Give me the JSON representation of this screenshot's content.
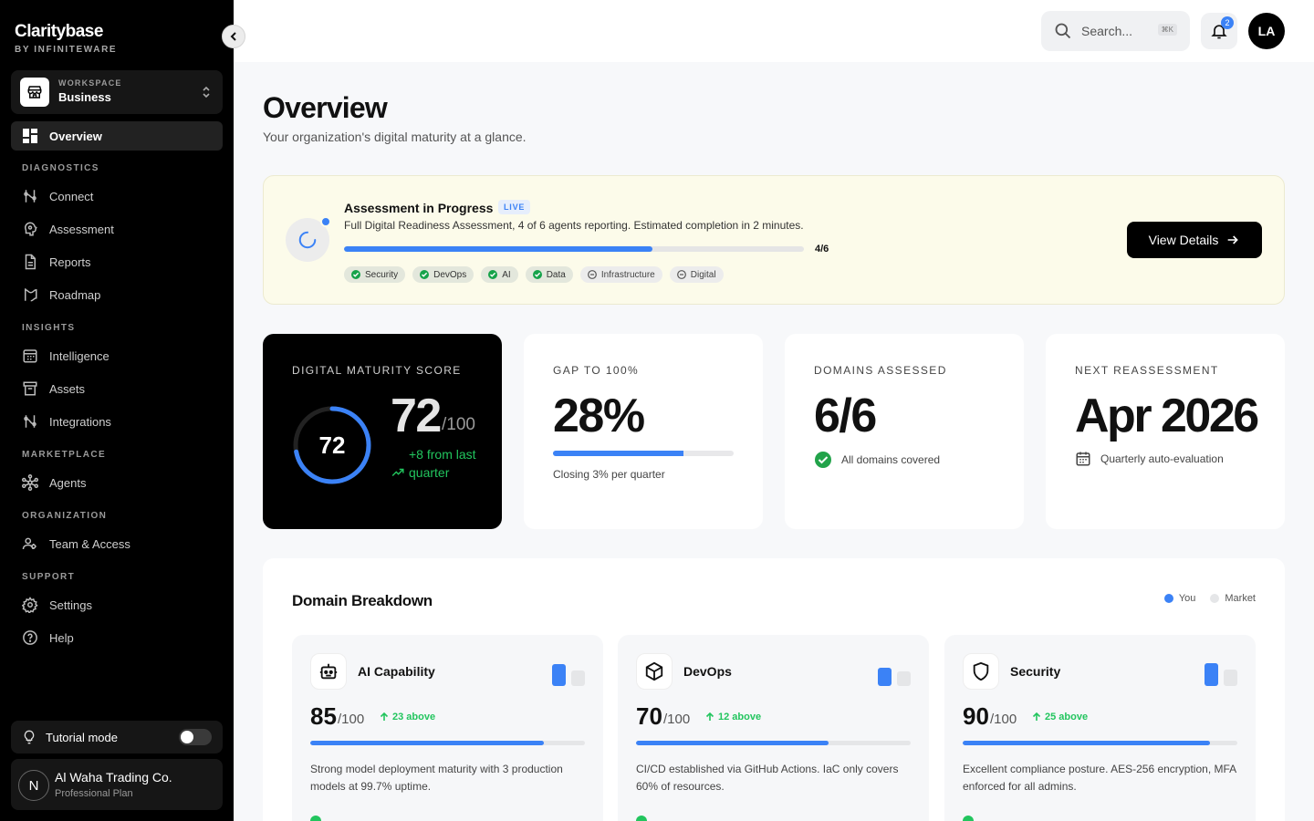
{
  "brand": {
    "name": "Claritybase",
    "by": "BY INFINITEWARE"
  },
  "workspace": {
    "label": "WORKSPACE",
    "value": "Business"
  },
  "nav": {
    "overview": "Overview",
    "sections": {
      "diagnostics": "DIAGNOSTICS",
      "insights": "INSIGHTS",
      "marketplace": "MARKETPLACE",
      "organization": "ORGANIZATION",
      "support": "SUPPORT"
    },
    "items": {
      "connect": "Connect",
      "assessment": "Assessment",
      "reports": "Reports",
      "roadmap": "Roadmap",
      "intelligence": "Intelligence",
      "assets": "Assets",
      "integrations": "Integrations",
      "agents": "Agents",
      "team": "Team & Access",
      "settings": "Settings",
      "help": "Help"
    }
  },
  "tutorial": {
    "label": "Tutorial mode",
    "enabled": false
  },
  "org": {
    "initial": "N",
    "name": "Al Waha Trading Co.",
    "plan": "Professional Plan"
  },
  "topbar": {
    "search_placeholder": "Search...",
    "shortcut": "⌘K",
    "notifications": "2",
    "avatar": "LA"
  },
  "page": {
    "title": "Overview",
    "subtitle": "Your organization's digital maturity at a glance."
  },
  "assessment": {
    "title": "Assessment in Progress",
    "badge": "LIVE",
    "description": "Full Digital Readiness Assessment, 4 of 6 agents reporting. Estimated completion in 2 minutes.",
    "progress": 0.67,
    "fraction": "4/6",
    "chips": [
      {
        "label": "Security",
        "done": true
      },
      {
        "label": "DevOps",
        "done": true
      },
      {
        "label": "AI",
        "done": true
      },
      {
        "label": "Data",
        "done": true
      },
      {
        "label": "Infrastructure",
        "done": false
      },
      {
        "label": "Digital",
        "done": false
      }
    ],
    "button": "View Details"
  },
  "cards": {
    "maturity": {
      "label": "DIGITAL MATURITY SCORE",
      "value": "72",
      "of": "/100",
      "gauge_value": 72,
      "trend": "+8 from last quarter"
    },
    "gap": {
      "label": "GAP TO 100%",
      "value": "28%",
      "progress": 0.72,
      "note": "Closing 3% per quarter"
    },
    "domains": {
      "label": "DOMAINS ASSESSED",
      "value": "6/6",
      "note": "All domains covered"
    },
    "next": {
      "label": "NEXT REASSESSMENT",
      "value": "Apr 2026",
      "note": "Quarterly auto-evaluation"
    }
  },
  "domain_breakdown": {
    "title": "Domain Breakdown",
    "legend": {
      "you": "You",
      "market": "Market"
    },
    "colors": {
      "you": "#3b82f6",
      "market": "#e5e6e8"
    },
    "items": [
      {
        "name": "AI Capability",
        "icon": "robot-icon",
        "score": "85",
        "of": "/100",
        "above": "23 above",
        "value": 85,
        "market": 62,
        "desc": "Strong model deployment maturity with 3 production models at 99.7% uptime."
      },
      {
        "name": "DevOps",
        "icon": "cube-icon",
        "score": "70",
        "of": "/100",
        "above": "12 above",
        "value": 70,
        "market": 58,
        "desc": "CI/CD established via GitHub Actions. IaC only covers 60% of resources."
      },
      {
        "name": "Security",
        "icon": "shield-icon",
        "score": "90",
        "of": "/100",
        "above": "25 above",
        "value": 90,
        "market": 65,
        "desc": "Excellent compliance posture. AES-256 encryption, MFA enforced for all admins."
      }
    ]
  }
}
